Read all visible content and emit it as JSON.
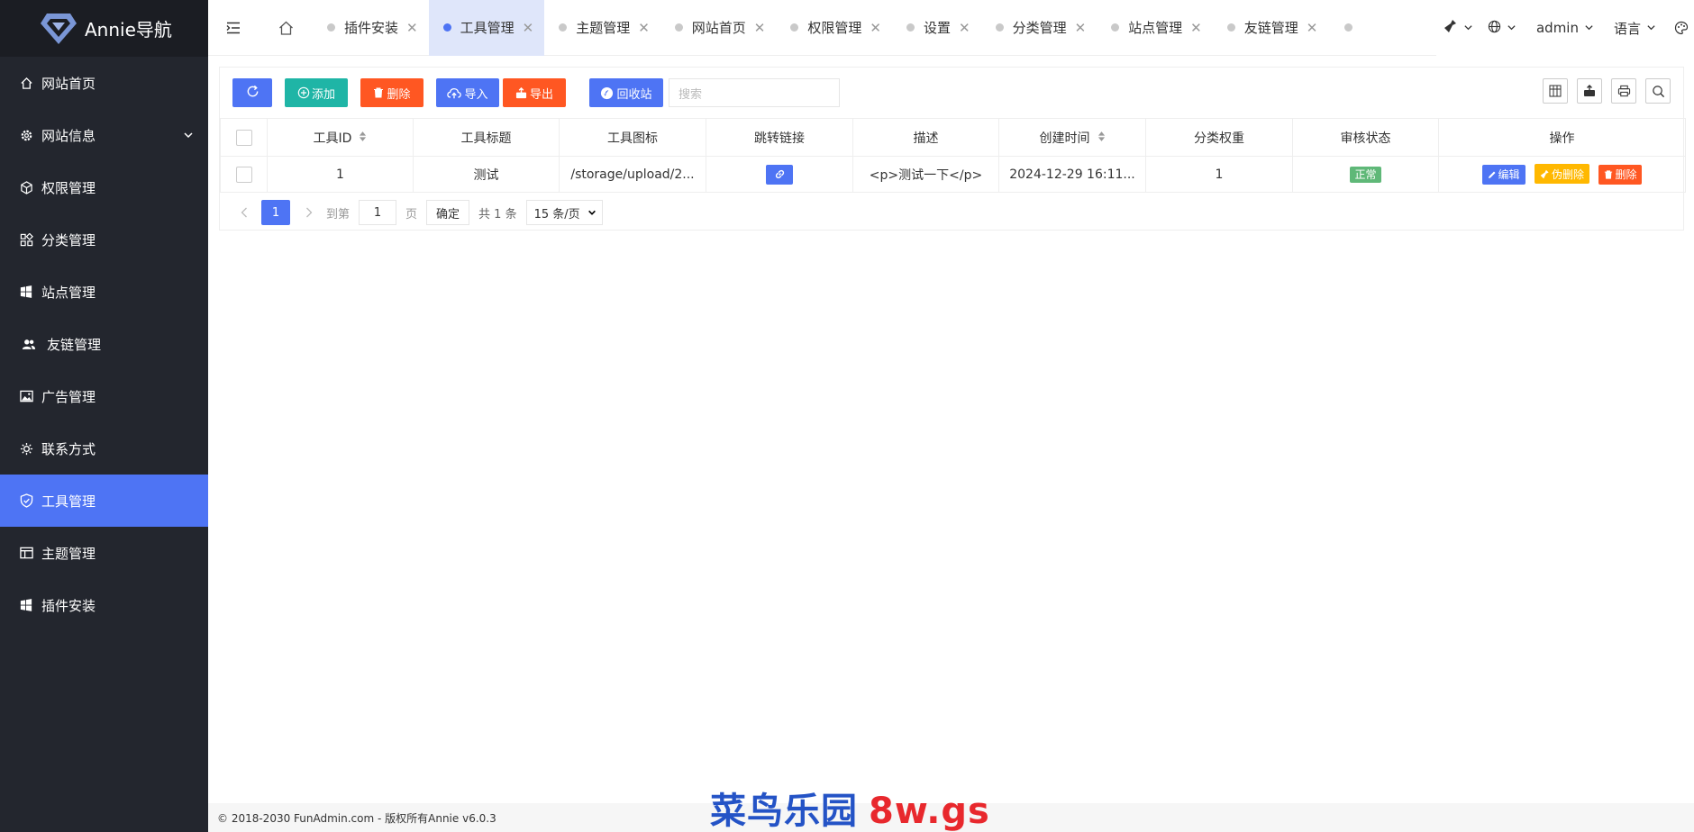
{
  "brand": {
    "name": "Annie导航"
  },
  "sidebar": {
    "items": [
      {
        "label": "网站首页",
        "icon": "home-icon"
      },
      {
        "label": "网站信息",
        "icon": "gear-icon",
        "expandable": true
      },
      {
        "label": "权限管理",
        "icon": "cube-icon"
      },
      {
        "label": "分类管理",
        "icon": "grid-icon"
      },
      {
        "label": "站点管理",
        "icon": "windows-icon"
      },
      {
        "label": "友链管理",
        "icon": "users-icon"
      },
      {
        "label": "广告管理",
        "icon": "image-icon"
      },
      {
        "label": "联系方式",
        "icon": "sun-icon"
      },
      {
        "label": "工具管理",
        "icon": "shield-icon",
        "active": true
      },
      {
        "label": "主题管理",
        "icon": "layout-icon"
      },
      {
        "label": "插件安装",
        "icon": "windows-icon"
      }
    ]
  },
  "tabs": [
    {
      "label": "插件安装"
    },
    {
      "label": "工具管理",
      "active": true
    },
    {
      "label": "主题管理"
    },
    {
      "label": "网站首页"
    },
    {
      "label": "权限管理"
    },
    {
      "label": "设置"
    },
    {
      "label": "分类管理"
    },
    {
      "label": "站点管理"
    },
    {
      "label": "友链管理"
    }
  ],
  "header": {
    "user": "admin",
    "language": "语言"
  },
  "toolbar": {
    "add": "添加",
    "delete": "删除",
    "import": "导入",
    "export": "导出",
    "recycle": "回收站",
    "search_placeholder": "搜索"
  },
  "table": {
    "columns": [
      "工具ID",
      "工具标题",
      "工具图标",
      "跳转链接",
      "描述",
      "创建时间",
      "分类权重",
      "审核状态",
      "操作"
    ],
    "rows": [
      {
        "id": "1",
        "title": "测试",
        "icon_path": "/storage/upload/2...",
        "description": "<p>测试一下</p>",
        "created": "2024-12-29 16:11...",
        "weight": "1",
        "status": "正常",
        "actions": {
          "edit": "编辑",
          "soft_delete": "伪删除",
          "delete": "删除"
        }
      }
    ]
  },
  "pager": {
    "current": "1",
    "goto_label": "到第",
    "goto_value": "1",
    "page_unit": "页",
    "confirm": "确定",
    "total": "共 1 条",
    "per_page": "15 条/页"
  },
  "footer": {
    "copyright": "© 2018-2030 FunAdmin.com - 版权所有Annie v6.0.3"
  },
  "watermark": {
    "cn": "菜鸟乐园",
    "en": "8w.gs"
  },
  "colors": {
    "primary": "#4e74f4",
    "sidebar_bg": "#23262e",
    "danger": "#ff5722",
    "teal": "#1fb5a6",
    "warning": "#ffb800",
    "success": "#5fb878"
  }
}
